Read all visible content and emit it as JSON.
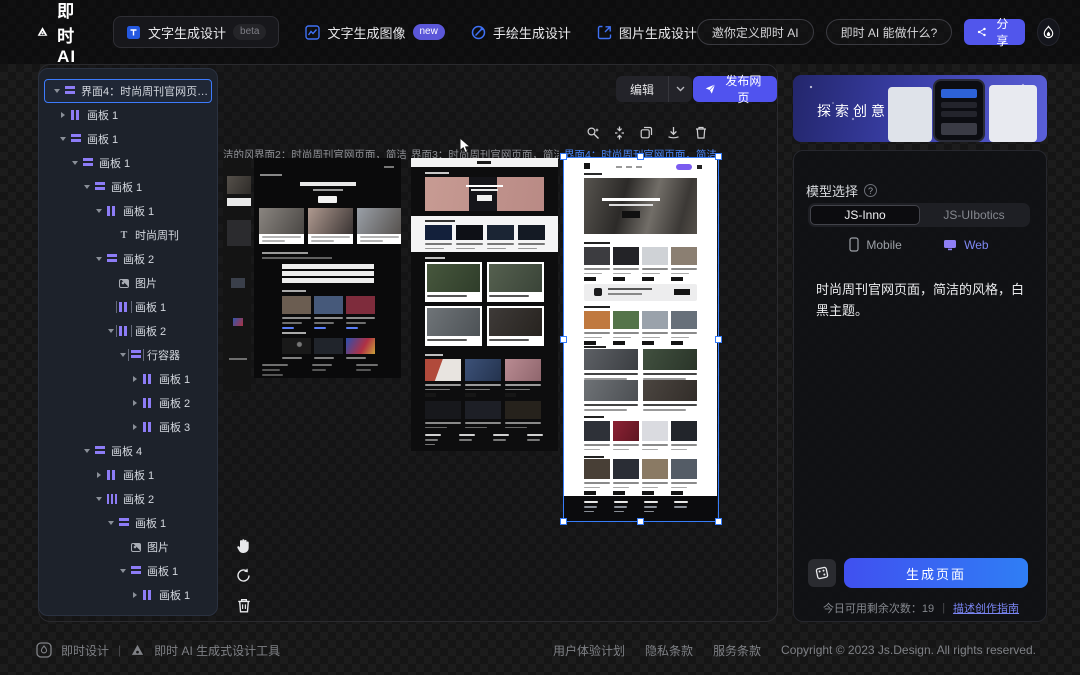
{
  "navbar": {
    "logo_text": "即时AI",
    "items": [
      {
        "label": "文字生成设计",
        "icon": "text-design",
        "badge": "beta",
        "badge_style": "dim",
        "active": true
      },
      {
        "label": "文字生成图像",
        "icon": "text-image",
        "badge": "new",
        "badge_style": "new",
        "active": false
      },
      {
        "label": "手绘生成设计",
        "icon": "sketch",
        "active": false
      },
      {
        "label": "图片生成设计",
        "icon": "image-design",
        "active": false
      }
    ],
    "pills": [
      "邀你定义即时 AI",
      "即时 AI 能做什么?"
    ],
    "share_label": "分享"
  },
  "canvas": {
    "edit_label": "编辑",
    "publish_label": "发布网页",
    "frames": [
      {
        "label": "洁的风…",
        "selected": false
      },
      {
        "label": "界面2：时尚周刊官网页面，简洁的风…",
        "selected": false
      },
      {
        "label": "界面3：时尚周刊官网页面，简洁的风…",
        "selected": false
      },
      {
        "label": "界面4：时尚周刊官网页面，简洁的风…",
        "selected": true
      }
    ]
  },
  "layers": {
    "items": [
      {
        "label": "界面4：时尚周刊官网页面，简…",
        "level": 0,
        "caret": "down",
        "icon": "rows",
        "selected": true
      },
      {
        "label": "画板 1",
        "level": 1,
        "caret": "right",
        "icon": "cols"
      },
      {
        "label": "画板 1",
        "level": 1,
        "caret": "down",
        "icon": "rows"
      },
      {
        "label": "画板 1",
        "level": 2,
        "caret": "down",
        "icon": "rows"
      },
      {
        "label": "画板 1",
        "level": 3,
        "caret": "down",
        "icon": "rows"
      },
      {
        "label": "画板 1",
        "level": 4,
        "caret": "down",
        "icon": "cols"
      },
      {
        "label": "时尚周刊",
        "level": 5,
        "caret": "none",
        "icon": "text"
      },
      {
        "label": "画板 2",
        "level": 4,
        "caret": "down",
        "icon": "rows"
      },
      {
        "label": "图片",
        "level": 5,
        "caret": "none",
        "icon": "image"
      },
      {
        "label": "画板 1",
        "level": 5,
        "caret": "none",
        "icon": "cols-br"
      },
      {
        "label": "画板 2",
        "level": 5,
        "caret": "down",
        "icon": "cols-br"
      },
      {
        "label": "行容器",
        "level": 6,
        "caret": "down",
        "icon": "rows-br"
      },
      {
        "label": "画板 1",
        "level": 7,
        "caret": "right",
        "icon": "cols"
      },
      {
        "label": "画板 2",
        "level": 7,
        "caret": "right",
        "icon": "cols"
      },
      {
        "label": "画板 3",
        "level": 7,
        "caret": "right",
        "icon": "cols"
      },
      {
        "label": "画板 4",
        "level": 3,
        "caret": "down",
        "icon": "rows"
      },
      {
        "label": "画板 1",
        "level": 4,
        "caret": "right",
        "icon": "cols"
      },
      {
        "label": "画板 2",
        "level": 4,
        "caret": "down",
        "icon": "cols3"
      },
      {
        "label": "画板 1",
        "level": 5,
        "caret": "down",
        "icon": "rows"
      },
      {
        "label": "图片",
        "level": 6,
        "caret": "none",
        "icon": "image"
      },
      {
        "label": "画板 1",
        "level": 6,
        "caret": "down",
        "icon": "rows"
      },
      {
        "label": "画板 1",
        "level": 7,
        "caret": "right",
        "icon": "cols"
      }
    ]
  },
  "right_panel": {
    "banner_title": "探索创意",
    "model_label": "模型选择",
    "models": [
      "JS-Inno",
      "JS-UIbotics"
    ],
    "active_model": "JS-Inno",
    "platforms": [
      "Mobile",
      "Web"
    ],
    "active_platform": "Web",
    "prompt": "时尚周刊官网页面，简洁的风格，白黑主题。",
    "generate_label": "生成页面",
    "quota_text": "今日可用剩余次数：19",
    "guide_link": "描述创作指南"
  },
  "footer": {
    "brand": "即时设计",
    "product": "即时 AI 生成式设计工具",
    "links": [
      "用户体验计划",
      "隐私条款",
      "服务条款"
    ],
    "copyright": "Copyright © 2023 Js.Design. All rights reserved."
  },
  "colors": {
    "accent": "#5156ec",
    "selection": "#377dfa",
    "layer_icon": "#8d7cf6",
    "generate_gradient": [
      "#4050f0",
      "#2f7ef5"
    ],
    "new_badge": "#5b57d9"
  }
}
